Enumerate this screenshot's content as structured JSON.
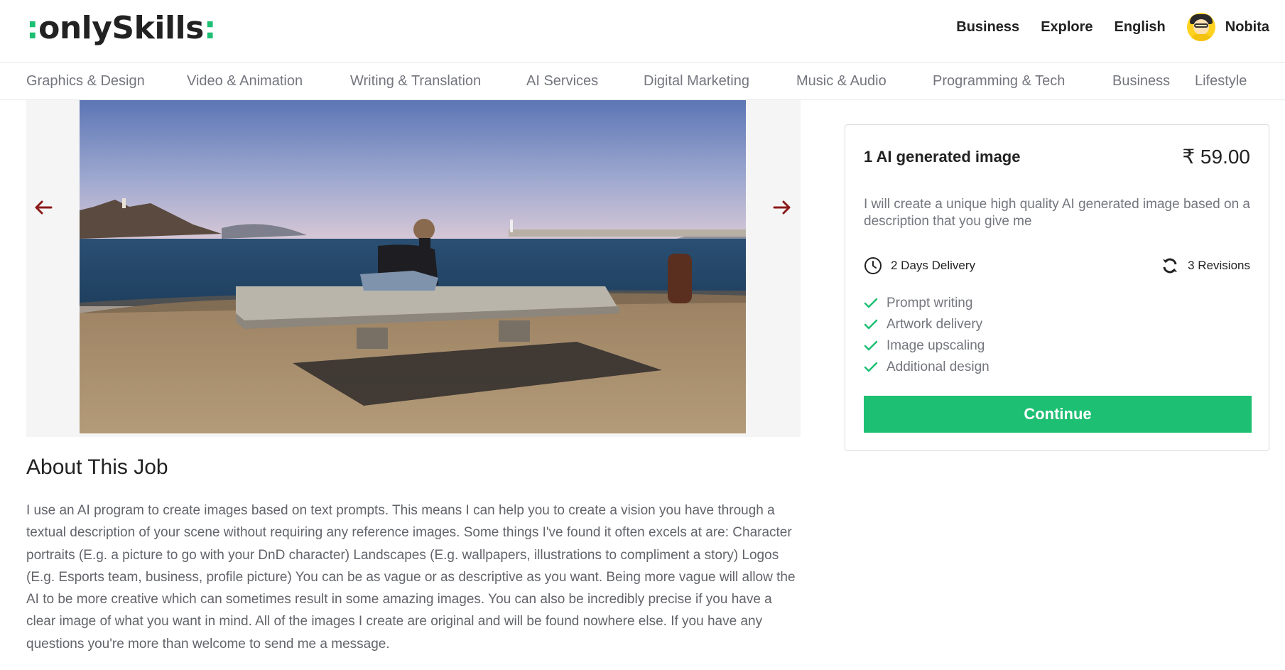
{
  "brand": {
    "logo_prefix": ":",
    "logo_text": "onlySkills",
    "logo_suffix": ":",
    "accent_color": "#1dbf73"
  },
  "header": {
    "nav": [
      "Business",
      "Explore",
      "English"
    ],
    "user": {
      "name": "Nobita",
      "avatar_icon": "cartoon-avatar-icon"
    }
  },
  "categories": [
    "Graphics & Design",
    "Video & Animation",
    "Writing & Translation",
    "AI Services",
    "Digital Marketing",
    "Music & Audio",
    "Programming & Tech",
    "Business",
    "Lifestyle"
  ],
  "gallery": {
    "prev_icon": "arrow-left-icon",
    "next_icon": "arrow-right-icon",
    "arrow_color": "#8b1a1a"
  },
  "about": {
    "title": "About This Job",
    "text": "I use an AI program to create images based on text prompts. This means I can help you to create a vision you have through a textual description of your scene without requiring any reference images. Some things I've found it often excels at are: Character portraits (E.g. a picture to go with your DnD character) Landscapes (E.g. wallpapers, illustrations to compliment a story) Logos (E.g. Esports team, business, profile picture) You can be as vague or as descriptive as you want. Being more vague will allow the AI to be more creative which can sometimes result in some amazing images. You can also be incredibly precise if you have a clear image of what you want in mind. All of the images I create are original and will be found nowhere else. If you have any questions you're more than welcome to send me a message."
  },
  "package": {
    "title": "1 AI generated image",
    "price": "₹ 59.00",
    "description": "I will create a unique high quality AI generated image based on a description that you give me",
    "delivery": "2 Days Delivery",
    "revisions": "3 Revisions",
    "features": [
      "Prompt writing",
      "Artwork delivery",
      "Image upscaling",
      "Additional design"
    ],
    "continue_label": "Continue"
  }
}
